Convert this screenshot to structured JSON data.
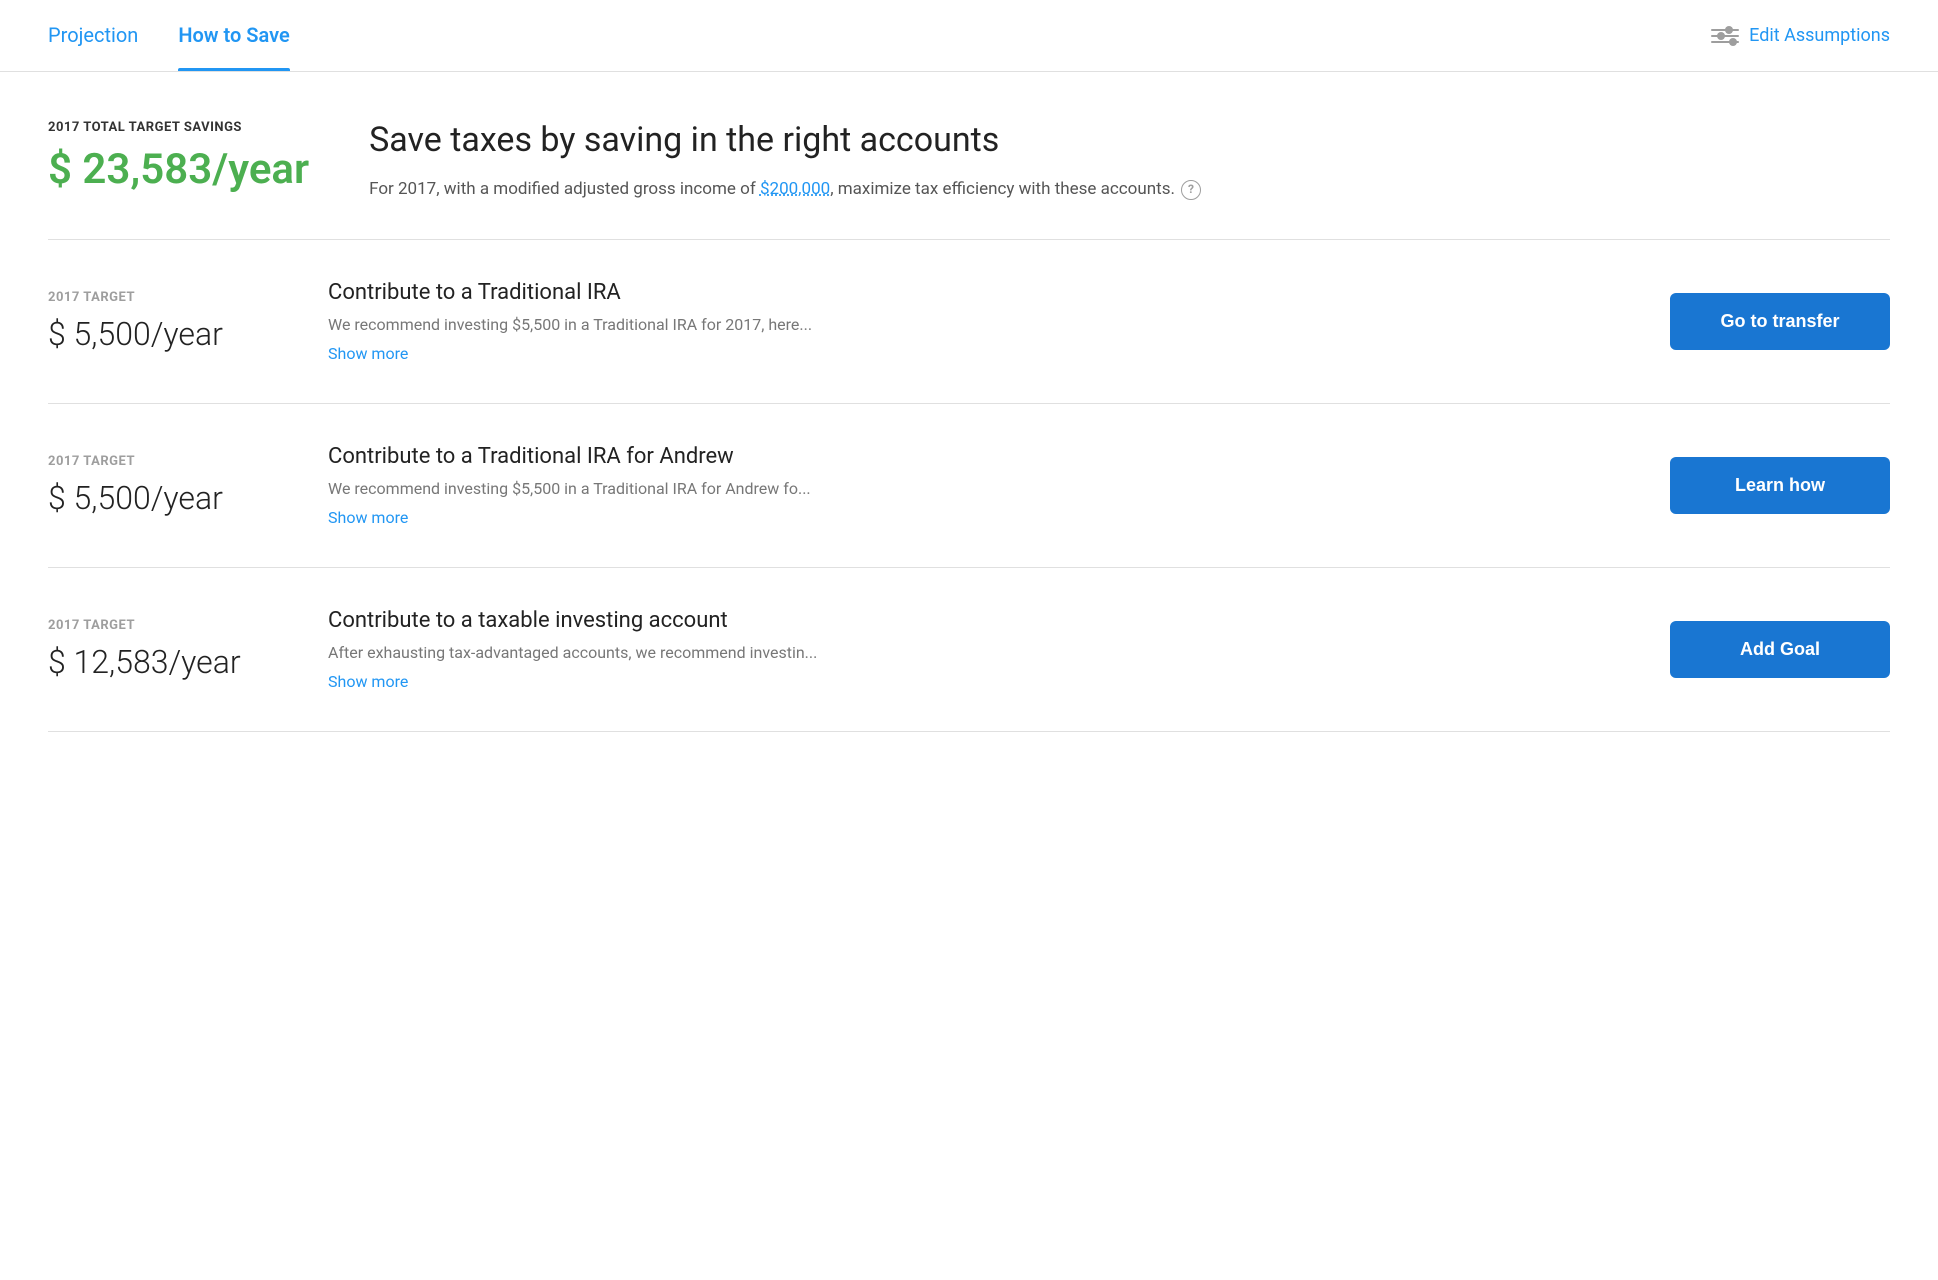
{
  "tabs": {
    "projection": {
      "label": "Projection",
      "active": false
    },
    "how_to_save": {
      "label": "How to Save",
      "active": true
    }
  },
  "header": {
    "edit_assumptions": "Edit Assumptions"
  },
  "hero": {
    "label": "2017 TOTAL TARGET SAVINGS",
    "amount": "$ 23,583/year",
    "title": "Save taxes by saving in the right accounts",
    "description_prefix": "For 2017, with a modified adjusted gross income of ",
    "income_link": "$200,000",
    "description_suffix": ", maximize tax efficiency with these accounts.",
    "info_icon": "?"
  },
  "rows": [
    {
      "label": "2017 TARGET",
      "amount": "$ 5,500/year",
      "title": "Contribute to a Traditional IRA",
      "description": "We recommend investing $5,500 in a Traditional IRA for 2017, here...",
      "show_more": "Show more",
      "button_label": "Go to transfer"
    },
    {
      "label": "2017 TARGET",
      "amount": "$ 5,500/year",
      "title": "Contribute to a Traditional IRA for Andrew",
      "description": "We recommend investing $5,500 in a Traditional IRA for Andrew fo...",
      "show_more": "Show more",
      "button_label": "Learn how"
    },
    {
      "label": "2017 TARGET",
      "amount": "$ 12,583/year",
      "title": "Contribute to a taxable investing account",
      "description": "After exhausting tax-advantaged accounts, we recommend investin...",
      "show_more": "Show more",
      "button_label": "Add Goal"
    }
  ]
}
